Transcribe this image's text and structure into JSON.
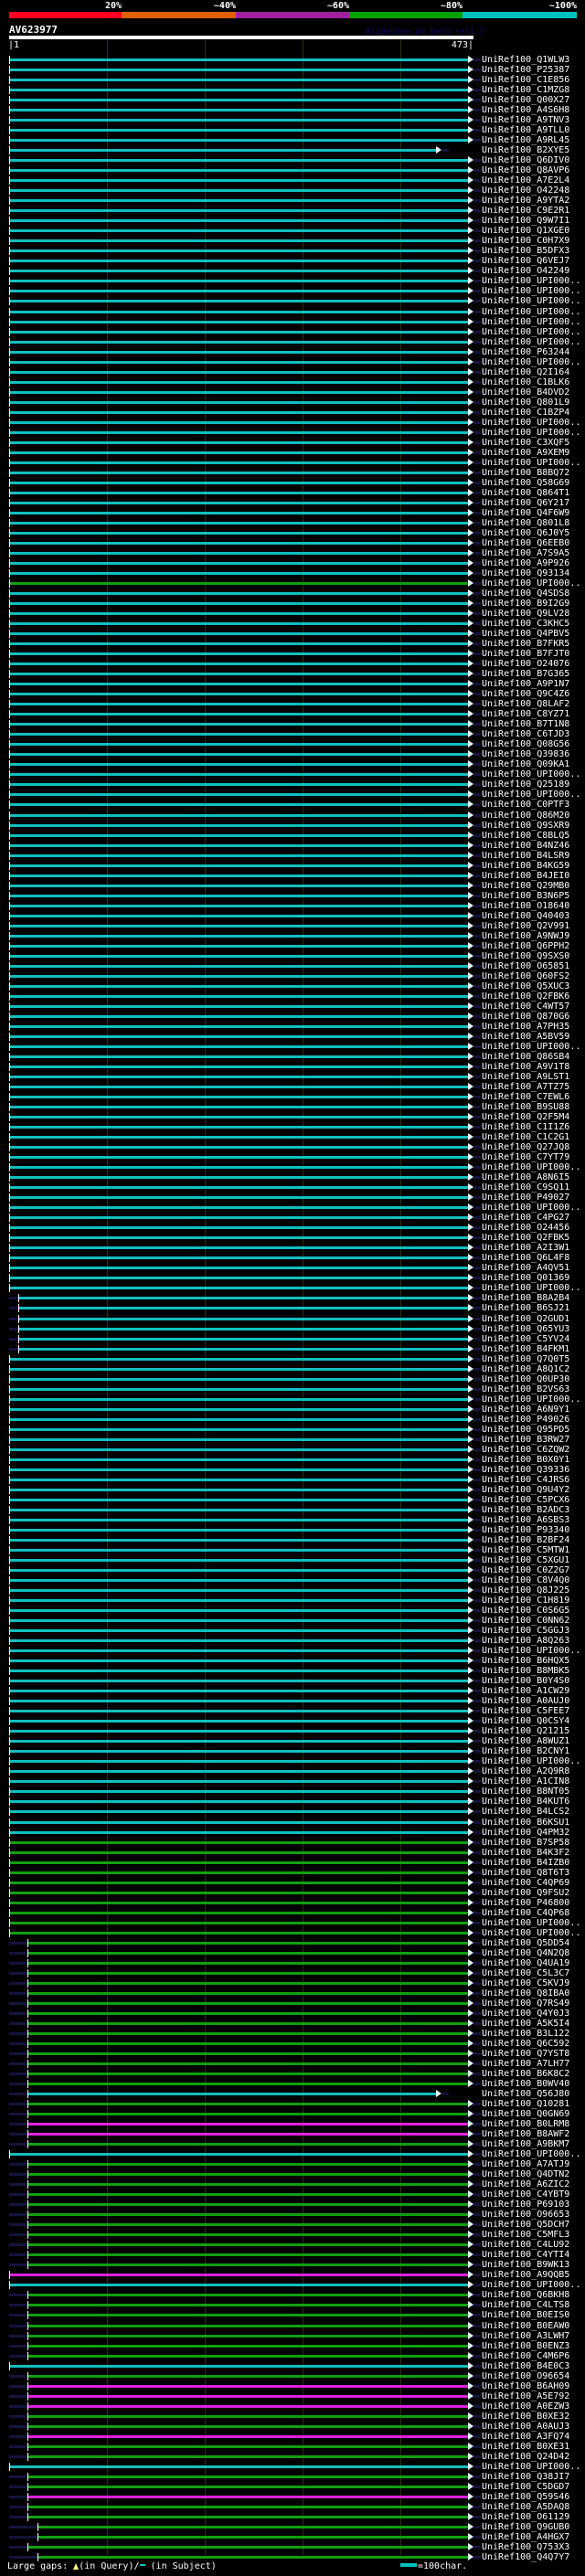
{
  "legend": {
    "items": [
      {
        "label": "20%",
        "color": "#ff0020"
      },
      {
        "label": "~40%",
        "color": "#e06000"
      },
      {
        "label": "~60%",
        "color": "#a020a0"
      },
      {
        "label": "~80%",
        "color": "#00a000"
      },
      {
        "label": "~100%",
        "color": "#00c0c0"
      }
    ]
  },
  "query": {
    "name": "AV623977",
    "start_label": "|1",
    "end_label": "473|",
    "length": 473
  },
  "credit": "AlignView.pm Beta rel1.7",
  "colors": {
    "cyan": "#10c0c0",
    "green": "#10a010",
    "magenta": "#e020e0"
  },
  "rows": [
    [
      "UniRef100_Q1WLW3",
      "cyan",
      1,
      473
    ],
    [
      "UniRef100_P25387",
      "cyan",
      1,
      473
    ],
    [
      "UniRef100_C1E856",
      "cyan",
      1,
      473
    ],
    [
      "UniRef100_C1MZG8",
      "cyan",
      1,
      473
    ],
    [
      "UniRef100_Q00X27",
      "cyan",
      1,
      473
    ],
    [
      "UniRef100_A4S6H8",
      "cyan",
      1,
      473
    ],
    [
      "UniRef100_A9TNV3",
      "cyan",
      1,
      473
    ],
    [
      "UniRef100_A9TLL0",
      "cyan",
      1,
      473
    ],
    [
      "UniRef100_A9RL45",
      "cyan",
      1,
      473
    ],
    [
      "UniRef100_B2XYE5",
      "cyan",
      1,
      440
    ],
    [
      "UniRef100_Q6DIV0",
      "cyan",
      1,
      473
    ],
    [
      "UniRef100_Q8AVP6",
      "cyan",
      1,
      473
    ],
    [
      "UniRef100_A7E2L4",
      "cyan",
      1,
      473
    ],
    [
      "UniRef100_O42248",
      "cyan",
      1,
      473
    ],
    [
      "UniRef100_A9YTA2",
      "cyan",
      1,
      473
    ],
    [
      "UniRef100_C9E2R1",
      "cyan",
      1,
      473
    ],
    [
      "UniRef100_Q9W7I1",
      "cyan",
      1,
      473
    ],
    [
      "UniRef100_Q1XGE0",
      "cyan",
      1,
      473
    ],
    [
      "UniRef100_C0H7X9",
      "cyan",
      1,
      473
    ],
    [
      "UniRef100_B5DFX3",
      "cyan",
      1,
      473
    ],
    [
      "UniRef100_Q6VEJ7",
      "cyan",
      1,
      473
    ],
    [
      "UniRef100_O42249",
      "cyan",
      1,
      473
    ],
    [
      "UniRef100_UPI000..",
      "cyan",
      1,
      473
    ],
    [
      "UniRef100_UPI000..",
      "cyan",
      1,
      473
    ],
    [
      "UniRef100_UPI000..",
      "cyan",
      1,
      473
    ],
    [
      "UniRef100_UPI000..",
      "cyan",
      1,
      473
    ],
    [
      "UniRef100_UPI000..",
      "cyan",
      1,
      473
    ],
    [
      "UniRef100_UPI000..",
      "cyan",
      1,
      473
    ],
    [
      "UniRef100_UPI000..",
      "cyan",
      1,
      473
    ],
    [
      "UniRef100_P63244",
      "cyan",
      1,
      473
    ],
    [
      "UniRef100_UPI000..",
      "cyan",
      1,
      473
    ],
    [
      "UniRef100_Q2I164",
      "cyan",
      1,
      473
    ],
    [
      "UniRef100_C1BLK6",
      "cyan",
      1,
      473
    ],
    [
      "UniRef100_B4DVD2",
      "cyan",
      1,
      473
    ],
    [
      "UniRef100_Q801L9",
      "cyan",
      1,
      473
    ],
    [
      "UniRef100_C1BZP4",
      "cyan",
      1,
      473
    ],
    [
      "UniRef100_UPI000..",
      "cyan",
      1,
      473
    ],
    [
      "UniRef100_UPI000..",
      "cyan",
      1,
      473
    ],
    [
      "UniRef100_C3XQF5",
      "cyan",
      1,
      473
    ],
    [
      "UniRef100_A9XEM9",
      "cyan",
      1,
      473
    ],
    [
      "UniRef100_UPI000..",
      "cyan",
      1,
      473
    ],
    [
      "UniRef100_B8BQ72",
      "cyan",
      1,
      473
    ],
    [
      "UniRef100_Q58G69",
      "cyan",
      1,
      473
    ],
    [
      "UniRef100_Q864T1",
      "cyan",
      1,
      473
    ],
    [
      "UniRef100_Q6Y217",
      "cyan",
      1,
      473
    ],
    [
      "UniRef100_Q4F6W9",
      "cyan",
      1,
      473
    ],
    [
      "UniRef100_Q801L8",
      "cyan",
      1,
      473
    ],
    [
      "UniRef100_Q6J0Y5",
      "cyan",
      1,
      473
    ],
    [
      "UniRef100_Q6EEB0",
      "cyan",
      1,
      473
    ],
    [
      "UniRef100_A7S9A5",
      "cyan",
      1,
      473
    ],
    [
      "UniRef100_A9P926",
      "cyan",
      1,
      473
    ],
    [
      "UniRef100_Q93134",
      "cyan",
      1,
      473
    ],
    [
      "UniRef100_UPI000..",
      "green",
      1,
      473
    ],
    [
      "UniRef100_Q4SDS8",
      "cyan",
      1,
      473
    ],
    [
      "UniRef100_B9I2G9",
      "cyan",
      1,
      473
    ],
    [
      "UniRef100_Q9LV28",
      "cyan",
      1,
      473
    ],
    [
      "UniRef100_C3KHC5",
      "cyan",
      1,
      473
    ],
    [
      "UniRef100_Q4PBV5",
      "cyan",
      1,
      473
    ],
    [
      "UniRef100_B7FKR5",
      "cyan",
      1,
      473
    ],
    [
      "UniRef100_B7FJT0",
      "cyan",
      1,
      473
    ],
    [
      "UniRef100_O24076",
      "cyan",
      1,
      473
    ],
    [
      "UniRef100_B7G365",
      "cyan",
      1,
      473
    ],
    [
      "UniRef100_A9P1N7",
      "cyan",
      1,
      473
    ],
    [
      "UniRef100_Q9C4Z6",
      "cyan",
      1,
      473
    ],
    [
      "UniRef100_Q8LAF2",
      "cyan",
      1,
      473
    ],
    [
      "UniRef100_C8YZ71",
      "cyan",
      1,
      473
    ],
    [
      "UniRef100_B7T1N8",
      "cyan",
      1,
      473
    ],
    [
      "UniRef100_C6TJD3",
      "cyan",
      1,
      473
    ],
    [
      "UniRef100_Q08G56",
      "cyan",
      1,
      473
    ],
    [
      "UniRef100_Q39836",
      "cyan",
      1,
      473
    ],
    [
      "UniRef100_Q09KA1",
      "cyan",
      1,
      473
    ],
    [
      "UniRef100_UPI000..",
      "cyan",
      1,
      473
    ],
    [
      "UniRef100_Q25189",
      "cyan",
      1,
      473
    ],
    [
      "UniRef100_UPI000..",
      "cyan",
      1,
      473
    ],
    [
      "UniRef100_C0PTF3",
      "cyan",
      1,
      473
    ],
    [
      "UniRef100_Q86M20",
      "cyan",
      1,
      473
    ],
    [
      "UniRef100_Q9SXR9",
      "cyan",
      1,
      473
    ],
    [
      "UniRef100_C8BLQ5",
      "cyan",
      1,
      473
    ],
    [
      "UniRef100_B4NZ46",
      "cyan",
      1,
      473
    ],
    [
      "UniRef100_B4LSR9",
      "cyan",
      1,
      473
    ],
    [
      "UniRef100_B4KG59",
      "cyan",
      1,
      473
    ],
    [
      "UniRef100_B4JEI0",
      "cyan",
      1,
      473
    ],
    [
      "UniRef100_Q29MB0",
      "cyan",
      1,
      473
    ],
    [
      "UniRef100_B3N6P5",
      "cyan",
      1,
      473
    ],
    [
      "UniRef100_O18640",
      "cyan",
      1,
      473
    ],
    [
      "UniRef100_Q40403",
      "cyan",
      1,
      473
    ],
    [
      "UniRef100_Q2V991",
      "cyan",
      1,
      473
    ],
    [
      "UniRef100_A9NWJ9",
      "cyan",
      1,
      473
    ],
    [
      "UniRef100_Q6PPH2",
      "cyan",
      1,
      473
    ],
    [
      "UniRef100_Q9SXS0",
      "cyan",
      1,
      473
    ],
    [
      "UniRef100_O65851",
      "cyan",
      1,
      473
    ],
    [
      "UniRef100_Q60FS2",
      "cyan",
      1,
      473
    ],
    [
      "UniRef100_Q5XUC3",
      "cyan",
      1,
      473
    ],
    [
      "UniRef100_Q2FBK6",
      "cyan",
      1,
      473
    ],
    [
      "UniRef100_C4WT57",
      "cyan",
      1,
      473
    ],
    [
      "UniRef100_Q870G6",
      "cyan",
      1,
      473
    ],
    [
      "UniRef100_A7PH35",
      "cyan",
      1,
      473
    ],
    [
      "UniRef100_A5BV59",
      "cyan",
      1,
      473
    ],
    [
      "UniRef100_UPI000..",
      "cyan",
      1,
      473
    ],
    [
      "UniRef100_Q86SB4",
      "cyan",
      1,
      473
    ],
    [
      "UniRef100_A9V1T8",
      "cyan",
      1,
      473
    ],
    [
      "UniRef100_A9LST1",
      "cyan",
      1,
      473
    ],
    [
      "UniRef100_A7TZ75",
      "cyan",
      1,
      473
    ],
    [
      "UniRef100_C7EWL6",
      "cyan",
      1,
      473
    ],
    [
      "UniRef100_B9SU88",
      "cyan",
      1,
      473
    ],
    [
      "UniRef100_Q2F5M4",
      "cyan",
      1,
      473
    ],
    [
      "UniRef100_C1I1Z6",
      "cyan",
      1,
      473
    ],
    [
      "UniRef100_C1C2G1",
      "cyan",
      1,
      473
    ],
    [
      "UniRef100_Q27JQ8",
      "cyan",
      1,
      473
    ],
    [
      "UniRef100_C7YT79",
      "cyan",
      1,
      473
    ],
    [
      "UniRef100_UPI000..",
      "cyan",
      1,
      473
    ],
    [
      "UniRef100_A8N6I5",
      "cyan",
      1,
      473
    ],
    [
      "UniRef100_C9SQ11",
      "cyan",
      1,
      473
    ],
    [
      "UniRef100_P49027",
      "cyan",
      1,
      473
    ],
    [
      "UniRef100_UPI000..",
      "cyan",
      1,
      473
    ],
    [
      "UniRef100_C4PG27",
      "cyan",
      1,
      473
    ],
    [
      "UniRef100_O24456",
      "cyan",
      1,
      473
    ],
    [
      "UniRef100_Q2FBK5",
      "cyan",
      1,
      473
    ],
    [
      "UniRef100_A2I3W1",
      "cyan",
      1,
      473
    ],
    [
      "UniRef100_Q6L4F8",
      "cyan",
      1,
      473
    ],
    [
      "UniRef100_A4QV51",
      "cyan",
      1,
      473
    ],
    [
      "UniRef100_Q01369",
      "cyan",
      1,
      473
    ],
    [
      "UniRef100_UPI000..",
      "cyan",
      1,
      473
    ],
    [
      "UniRef100_B8A2B4",
      "cyan",
      10,
      473
    ],
    [
      "UniRef100_B6SJ21",
      "cyan",
      10,
      473
    ],
    [
      "UniRef100_Q2GUD1",
      "cyan",
      10,
      473
    ],
    [
      "UniRef100_Q65YU3",
      "cyan",
      10,
      473
    ],
    [
      "UniRef100_C5YV24",
      "cyan",
      10,
      473
    ],
    [
      "UniRef100_B4FKM1",
      "cyan",
      10,
      473
    ],
    [
      "UniRef100_Q7Q0T5",
      "cyan",
      1,
      473
    ],
    [
      "UniRef100_A8Q1C2",
      "cyan",
      1,
      473
    ],
    [
      "UniRef100_Q0UP30",
      "cyan",
      1,
      473
    ],
    [
      "UniRef100_B2VS63",
      "cyan",
      1,
      473
    ],
    [
      "UniRef100_UPI000..",
      "cyan",
      1,
      473
    ],
    [
      "UniRef100_A6N9Y1",
      "cyan",
      1,
      473
    ],
    [
      "UniRef100_P49026",
      "cyan",
      1,
      473
    ],
    [
      "UniRef100_Q95PD5",
      "cyan",
      1,
      473
    ],
    [
      "UniRef100_B3RW27",
      "cyan",
      1,
      473
    ],
    [
      "UniRef100_C6ZQW2",
      "cyan",
      1,
      473
    ],
    [
      "UniRef100_B0X0Y1",
      "cyan",
      1,
      473
    ],
    [
      "UniRef100_Q39336",
      "cyan",
      1,
      473
    ],
    [
      "UniRef100_C4JRS6",
      "cyan",
      1,
      473
    ],
    [
      "UniRef100_Q9U4Y2",
      "cyan",
      1,
      473
    ],
    [
      "UniRef100_C5PCX6",
      "cyan",
      1,
      473
    ],
    [
      "UniRef100_B2ADC3",
      "cyan",
      1,
      473
    ],
    [
      "UniRef100_A6SBS3",
      "cyan",
      1,
      473
    ],
    [
      "UniRef100_P93340",
      "cyan",
      1,
      473
    ],
    [
      "UniRef100_B2BF24",
      "cyan",
      1,
      473
    ],
    [
      "UniRef100_C5MTW1",
      "cyan",
      1,
      473
    ],
    [
      "UniRef100_C5XGU1",
      "cyan",
      1,
      473
    ],
    [
      "UniRef100_C0Z2G7",
      "cyan",
      1,
      473
    ],
    [
      "UniRef100_C8V4Q0",
      "cyan",
      1,
      473
    ],
    [
      "UniRef100_Q8J225",
      "cyan",
      1,
      473
    ],
    [
      "UniRef100_C1H819",
      "cyan",
      1,
      473
    ],
    [
      "UniRef100_C0S6G5",
      "cyan",
      1,
      473
    ],
    [
      "UniRef100_C0NN62",
      "cyan",
      1,
      473
    ],
    [
      "UniRef100_C5GGJ3",
      "cyan",
      1,
      473
    ],
    [
      "UniRef100_A8Q263",
      "cyan",
      1,
      473
    ],
    [
      "UniRef100_UPI000..",
      "cyan",
      1,
      473
    ],
    [
      "UniRef100_B6HQX5",
      "cyan",
      1,
      473
    ],
    [
      "UniRef100_B8MBK5",
      "cyan",
      1,
      473
    ],
    [
      "UniRef100_B0Y4S0",
      "cyan",
      1,
      473
    ],
    [
      "UniRef100_A1CW29",
      "cyan",
      1,
      473
    ],
    [
      "UniRef100_A0AUJ0",
      "cyan",
      1,
      473
    ],
    [
      "UniRef100_C5FEE7",
      "cyan",
      1,
      473
    ],
    [
      "UniRef100_Q0CSY4",
      "cyan",
      1,
      473
    ],
    [
      "UniRef100_Q21215",
      "cyan",
      1,
      473
    ],
    [
      "UniRef100_A8WUZ1",
      "cyan",
      1,
      473
    ],
    [
      "UniRef100_B2CNY1",
      "cyan",
      1,
      473
    ],
    [
      "UniRef100_UPI000..",
      "cyan",
      1,
      473
    ],
    [
      "UniRef100_A2Q9R8",
      "cyan",
      1,
      473
    ],
    [
      "UniRef100_A1CIN8",
      "cyan",
      1,
      473
    ],
    [
      "UniRef100_B8NT05",
      "cyan",
      1,
      473
    ],
    [
      "UniRef100_B4KUT6",
      "cyan",
      1,
      473
    ],
    [
      "UniRef100_B4LCS2",
      "cyan",
      1,
      473
    ],
    [
      "UniRef100_B6KSU1",
      "cyan",
      1,
      473
    ],
    [
      "UniRef100_Q4PM32",
      "cyan",
      1,
      473
    ],
    [
      "UniRef100_B7SP58",
      "green",
      1,
      473
    ],
    [
      "UniRef100_B4K3F2",
      "green",
      1,
      473
    ],
    [
      "UniRef100_B4IZB0",
      "green",
      1,
      473
    ],
    [
      "UniRef100_Q8T6T3",
      "green",
      1,
      473
    ],
    [
      "UniRef100_C4QP69",
      "green",
      1,
      473
    ],
    [
      "UniRef100_Q9FSU2",
      "green",
      1,
      473
    ],
    [
      "UniRef100_P46800",
      "green",
      1,
      473
    ],
    [
      "UniRef100_C4QP68",
      "green",
      1,
      473
    ],
    [
      "UniRef100_UPI000..",
      "green",
      1,
      473
    ],
    [
      "UniRef100_UPI000..",
      "green",
      1,
      473
    ],
    [
      "UniRef100_Q5DD54",
      "green",
      20,
      473
    ],
    [
      "UniRef100_Q4N2Q8",
      "green",
      20,
      473
    ],
    [
      "UniRef100_Q4UA19",
      "green",
      20,
      473
    ],
    [
      "UniRef100_C5L3C7",
      "green",
      20,
      473
    ],
    [
      "UniRef100_C5KVJ9",
      "green",
      20,
      473
    ],
    [
      "UniRef100_Q8IBA0",
      "green",
      20,
      473
    ],
    [
      "UniRef100_Q7RS49",
      "green",
      20,
      473
    ],
    [
      "UniRef100_Q4Y0J3",
      "green",
      20,
      473
    ],
    [
      "UniRef100_A5K5I4",
      "green",
      20,
      473
    ],
    [
      "UniRef100_B3L122",
      "green",
      20,
      473
    ],
    [
      "UniRef100_Q6C592",
      "green",
      20,
      473
    ],
    [
      "UniRef100_Q7YST8",
      "green",
      20,
      473
    ],
    [
      "UniRef100_A7LH77",
      "green",
      20,
      473
    ],
    [
      "UniRef100_B6K8C2",
      "green",
      20,
      473
    ],
    [
      "UniRef100_B0WV40",
      "green",
      20,
      473
    ],
    [
      "UniRef100_Q56J80",
      "cyan",
      20,
      440
    ],
    [
      "UniRef100_Q10281",
      "green",
      20,
      473
    ],
    [
      "UniRef100_Q0GN69",
      "green",
      20,
      473
    ],
    [
      "UniRef100_B0LRM8",
      "magenta",
      20,
      473
    ],
    [
      "UniRef100_B8AWF2",
      "magenta",
      20,
      473
    ],
    [
      "UniRef100_A9BKM7",
      "green",
      20,
      473
    ],
    [
      "UniRef100_UPI000..",
      "cyan",
      1,
      473
    ],
    [
      "UniRef100_A7ATJ9",
      "green",
      20,
      473
    ],
    [
      "UniRef100_Q4DTN2",
      "green",
      20,
      473
    ],
    [
      "UniRef100_A6ZIC2",
      "green",
      20,
      473
    ],
    [
      "UniRef100_C4YBT9",
      "green",
      20,
      473
    ],
    [
      "UniRef100_P69103",
      "green",
      20,
      473
    ],
    [
      "UniRef100_O96653",
      "green",
      20,
      473
    ],
    [
      "UniRef100_Q5DCH7",
      "green",
      20,
      473
    ],
    [
      "UniRef100_C5MFL3",
      "green",
      20,
      473
    ],
    [
      "UniRef100_C4LU92",
      "green",
      20,
      473
    ],
    [
      "UniRef100_C4YTI4",
      "green",
      20,
      473
    ],
    [
      "UniRef100_B9WK13",
      "green",
      20,
      473
    ],
    [
      "UniRef100_A9QQB5",
      "magenta",
      1,
      473
    ],
    [
      "UniRef100_UPI000..",
      "cyan",
      1,
      473
    ],
    [
      "UniRef100_Q6BKH8",
      "green",
      20,
      473
    ],
    [
      "UniRef100_C4LTS8",
      "green",
      20,
      473
    ],
    [
      "UniRef100_B0EIS0",
      "green",
      20,
      473
    ],
    [
      "UniRef100_B0EAW0",
      "green",
      20,
      473
    ],
    [
      "UniRef100_A3LWH7",
      "green",
      20,
      473
    ],
    [
      "UniRef100_B0ENZ3",
      "green",
      20,
      473
    ],
    [
      "UniRef100_C4M6P6",
      "green",
      20,
      473
    ],
    [
      "UniRef100_B4E0C3",
      "cyan",
      1,
      473
    ],
    [
      "UniRef100_O96654",
      "green",
      20,
      473
    ],
    [
      "UniRef100_B6AH09",
      "magenta",
      20,
      473
    ],
    [
      "UniRef100_A5E792",
      "magenta",
      20,
      473
    ],
    [
      "UniRef100_A0EZW3",
      "magenta",
      20,
      473
    ],
    [
      "UniRef100_B0XE32",
      "green",
      20,
      473
    ],
    [
      "UniRef100_A0AUJ3",
      "green",
      20,
      473
    ],
    [
      "UniRef100_A3FQ74",
      "magenta",
      20,
      473
    ],
    [
      "UniRef100_B0XE31",
      "green",
      20,
      473
    ],
    [
      "UniRef100_Q24D42",
      "green",
      20,
      473
    ],
    [
      "UniRef100_UPI000..",
      "cyan",
      1,
      473
    ],
    [
      "UniRef100_Q38JI7",
      "green",
      20,
      473
    ],
    [
      "UniRef100_C5DGD7",
      "green",
      20,
      473
    ],
    [
      "UniRef100_Q59S46",
      "magenta",
      20,
      473
    ],
    [
      "UniRef100_A5DAQ8",
      "green",
      20,
      473
    ],
    [
      "UniRef100_O61129",
      "green",
      20,
      473
    ],
    [
      "UniRef100_Q9GUB0",
      "green",
      30,
      473
    ],
    [
      "UniRef100_A4HGX7",
      "green",
      30,
      473
    ],
    [
      "UniRef100_Q753X3",
      "green",
      20,
      473
    ],
    [
      "UniRef100_Q4Q7Y7",
      "green",
      30,
      473
    ]
  ],
  "footer": {
    "gaps_label": "Large gaps:",
    "query_gap_label": "(in Query)/",
    "subject_gap_label": "(in Subject)",
    "scale_label": "=100char."
  }
}
